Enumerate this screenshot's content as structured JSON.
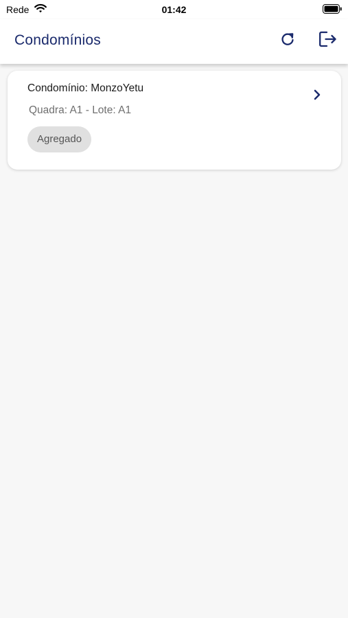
{
  "status_bar": {
    "carrier": "Rede",
    "time": "01:42",
    "icons": [
      "wifi-icon",
      "battery-icon"
    ]
  },
  "app_bar": {
    "title": "Condomínios",
    "actions": [
      {
        "name": "refresh",
        "icon": "refresh-icon"
      },
      {
        "name": "logout",
        "icon": "logout-icon"
      }
    ]
  },
  "condominiums": [
    {
      "title": "Condomínio: MonzoYetu",
      "subtitle": "Quadra: A1 - Lote: A1",
      "status": "Agregado",
      "icon": "chevron-right-icon"
    }
  ],
  "colors": {
    "accent": "#1a2a6c",
    "background": "#f7f7f7",
    "card": "#ffffff",
    "chip": "#e0e0e0"
  }
}
